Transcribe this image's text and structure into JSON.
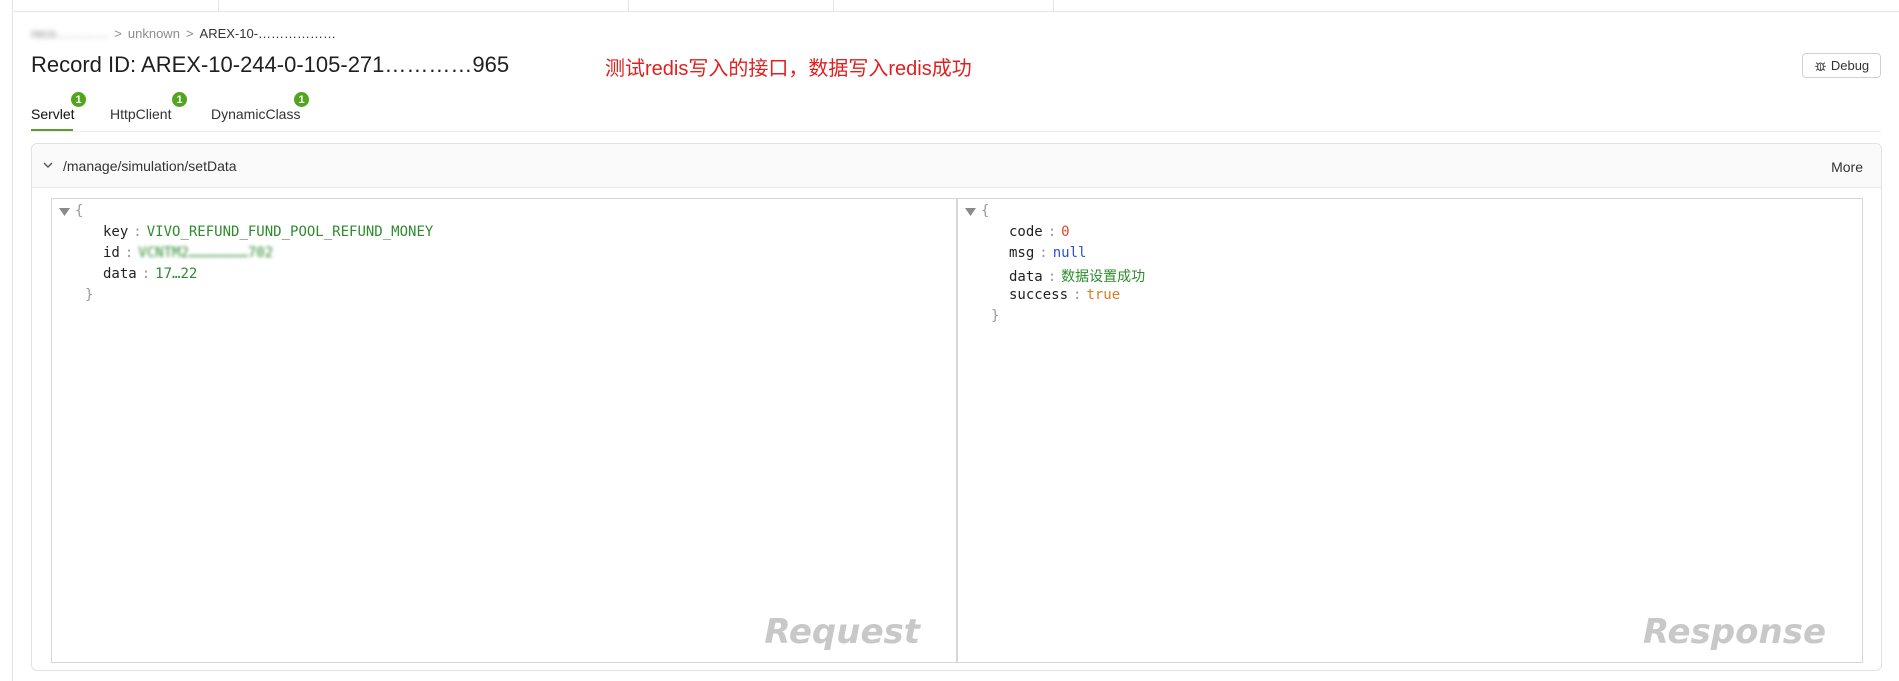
{
  "breadcrumb": {
    "items": [
      "reco…………",
      "unknown",
      "AREX-10-………………"
    ]
  },
  "record": {
    "title": "Record ID: AREX-10-244-0-105-271…………965",
    "annotation": "测试redis写入的接口，数据写入redis成功"
  },
  "toolbar": {
    "debug_label": "Debug"
  },
  "tabs": [
    {
      "label": "Servlet",
      "count": "1"
    },
    {
      "label": "HttpClient",
      "count": "1"
    },
    {
      "label": "DynamicClass",
      "count": "1"
    }
  ],
  "panel": {
    "path": "/manage/simulation/setData",
    "more_label": "More"
  },
  "request": {
    "watermark": "Request",
    "fields": [
      {
        "key": "key",
        "value": "VIVO_REFUND_FUND_POOL_REFUND_MONEY"
      },
      {
        "key": "id",
        "value": "VCNTM2…………………702"
      },
      {
        "key": "data",
        "value": "17…22"
      }
    ]
  },
  "response": {
    "watermark": "Response",
    "fields": [
      {
        "key": "code",
        "value": "0"
      },
      {
        "key": "msg",
        "value": "null"
      },
      {
        "key": "data",
        "value": "数据设置成功"
      },
      {
        "key": "success",
        "value": "true"
      }
    ]
  },
  "colors": {
    "accent": "#52a51f",
    "annotation": "#e02020",
    "string": "#2e8b2e",
    "number": "#e0442e",
    "null": "#2a4fd8",
    "boolean": "#e07b1f"
  }
}
